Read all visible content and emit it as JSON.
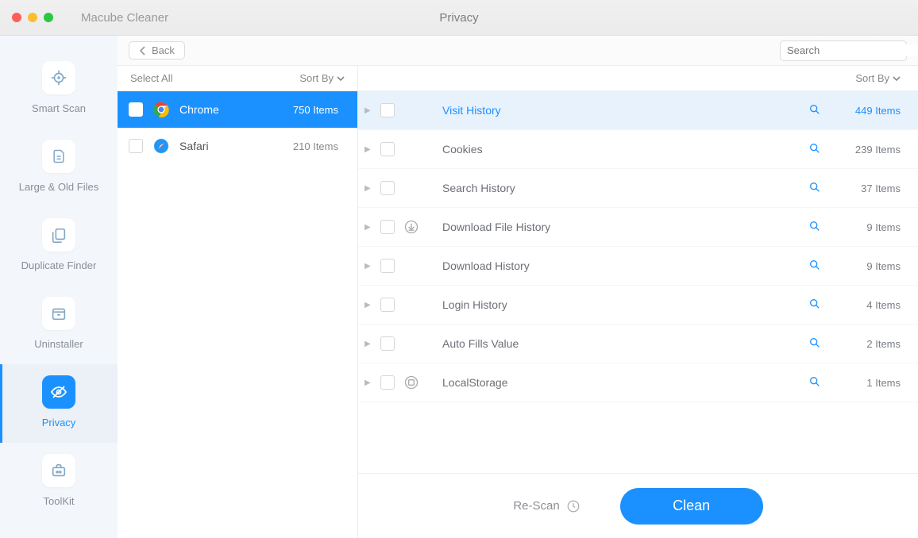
{
  "app_title": "Macube Cleaner",
  "window_title": "Privacy",
  "toolbar": {
    "back_label": "Back",
    "search_placeholder": "Search"
  },
  "sidebar": {
    "items": [
      {
        "label": "Smart Scan"
      },
      {
        "label": "Large & Old Files"
      },
      {
        "label": "Duplicate Finder"
      },
      {
        "label": "Uninstaller"
      },
      {
        "label": "Privacy"
      },
      {
        "label": "ToolKit"
      }
    ]
  },
  "browsers": {
    "select_all_label": "Select All",
    "sort_by_label": "Sort By",
    "items": [
      {
        "name": "Chrome",
        "count": "750 Items"
      },
      {
        "name": "Safari",
        "count": "210 Items"
      }
    ]
  },
  "details": {
    "sort_by_label": "Sort By",
    "items": [
      {
        "label": "Visit History",
        "count": "449 Items"
      },
      {
        "label": "Cookies",
        "count": "239 Items"
      },
      {
        "label": "Search History",
        "count": "37 Items"
      },
      {
        "label": "Download File History",
        "count": "9 Items"
      },
      {
        "label": "Download History",
        "count": "9 Items"
      },
      {
        "label": "Login History",
        "count": "4 Items"
      },
      {
        "label": "Auto Fills Value",
        "count": "2 Items"
      },
      {
        "label": "LocalStorage",
        "count": "1 Items"
      }
    ]
  },
  "bottom": {
    "rescan_label": "Re-Scan",
    "clean_label": "Clean"
  }
}
